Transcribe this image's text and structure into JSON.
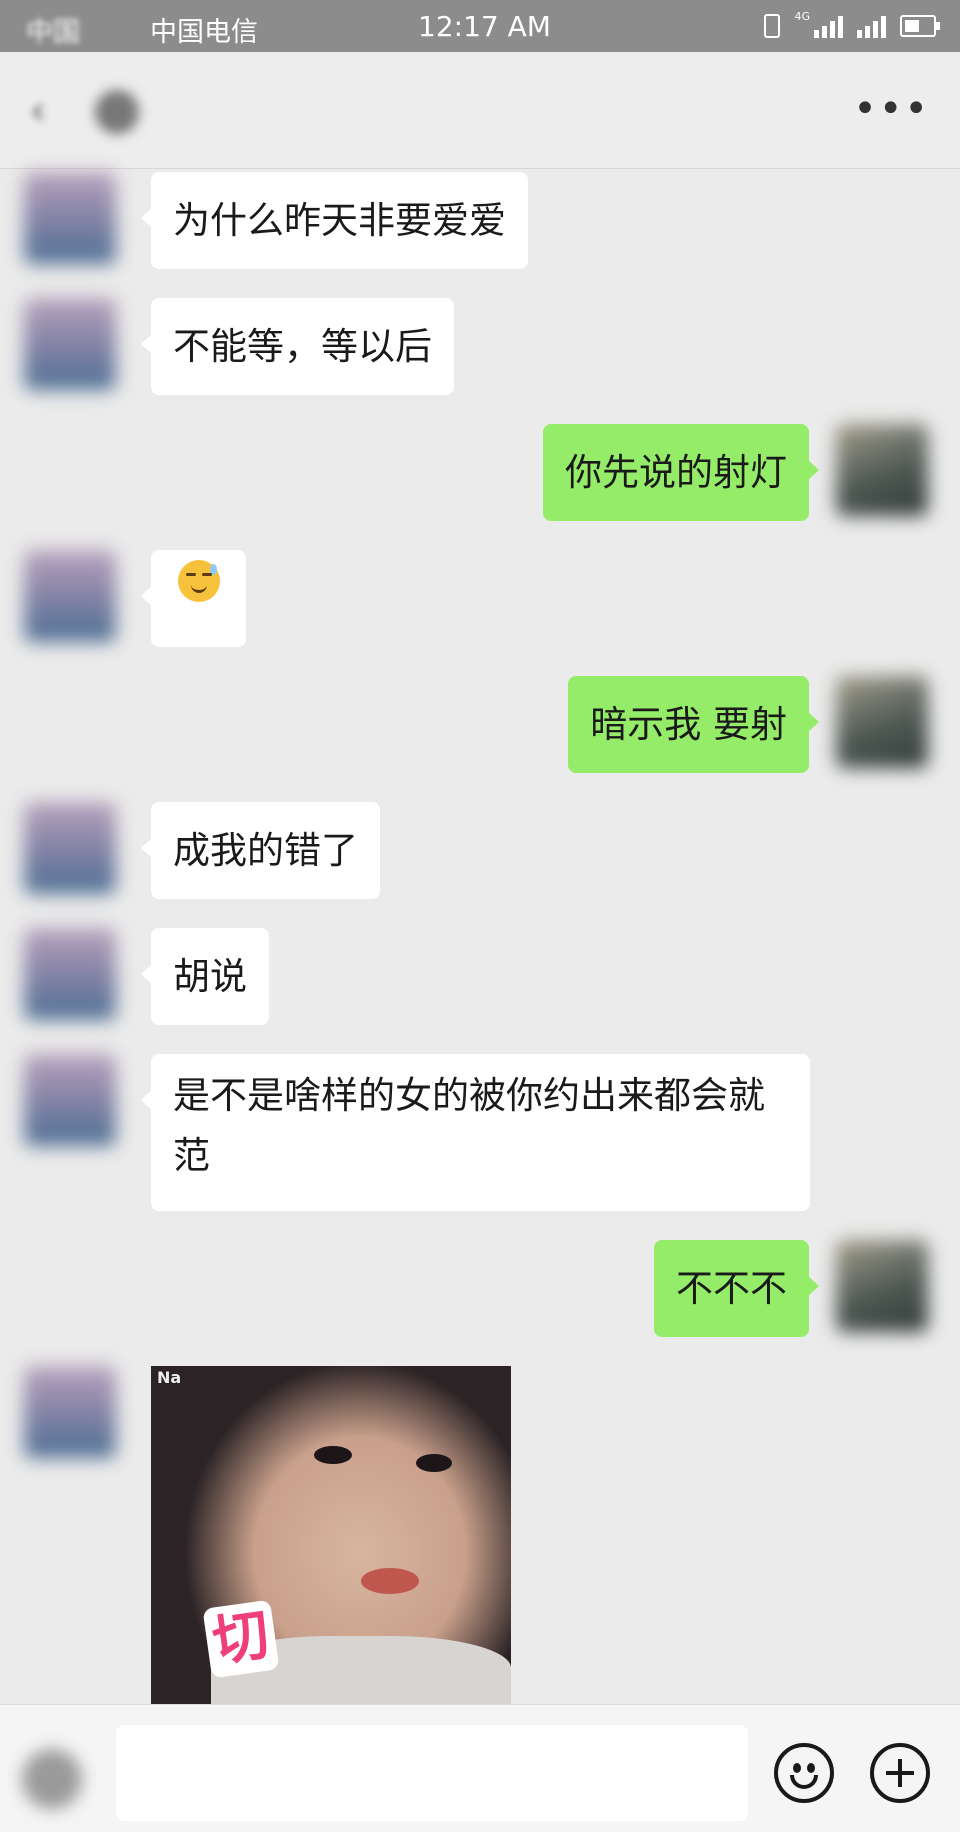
{
  "status_bar": {
    "carrier_1": "中国",
    "carrier_2": "中国电信",
    "time": "12:17 AM",
    "network": "4G"
  },
  "nav": {
    "more_label": "•••"
  },
  "messages": [
    {
      "from": "them",
      "text": "为什么昨天非要爱爱"
    },
    {
      "from": "them",
      "text": "不能等，等以后"
    },
    {
      "from": "me",
      "text": "你先说的射灯"
    },
    {
      "from": "them",
      "type": "emoji",
      "emoji": "sweat-grin-emoji"
    },
    {
      "from": "me",
      "text": "暗示我 要射"
    },
    {
      "from": "them",
      "text": "成我的错了"
    },
    {
      "from": "them",
      "text": "胡说"
    },
    {
      "from": "them",
      "text": "是不是啥样的女的被你约出来都会就范"
    },
    {
      "from": "me",
      "text": "不不不"
    },
    {
      "from": "them",
      "type": "sticker",
      "sticker_text": "切",
      "watermark": "Na"
    }
  ],
  "colors": {
    "my_bubble": "#95ec69",
    "their_bubble": "#ffffff",
    "background": "#ebebeb"
  }
}
